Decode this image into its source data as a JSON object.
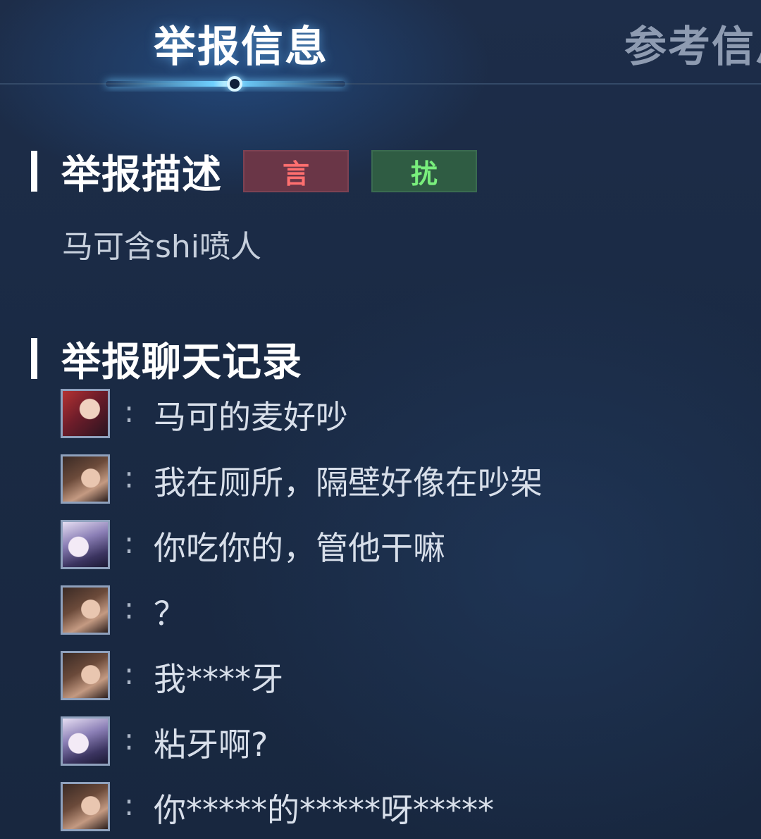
{
  "tabs": {
    "active_label": "举报信息",
    "inactive_label": "参考信息"
  },
  "report_description": {
    "title": "举报描述",
    "tag_red": "言",
    "tag_green": "扰",
    "text": "马可含shi喷人"
  },
  "chat_log": {
    "title": "举报聊天记录",
    "messages": [
      {
        "avatar": "hero-avatar-red",
        "text": "马可的麦好吵"
      },
      {
        "avatar": "hero-avatar-dark",
        "text": "我在厕所，隔壁好像在吵架"
      },
      {
        "avatar": "hero-avatar-purple",
        "text": "你吃你的，管他干嘛"
      },
      {
        "avatar": "hero-avatar-dark",
        "text": "？"
      },
      {
        "avatar": "hero-avatar-dark",
        "text": "我****牙"
      },
      {
        "avatar": "hero-avatar-purple",
        "text": "粘牙啊?"
      },
      {
        "avatar": "hero-avatar-dark",
        "text": "你*****的*****呀*****"
      }
    ]
  },
  "colors": {
    "background": "#1b2a44",
    "tab_indicator": "#6fd0ff",
    "tag_red_bg": "#6a3647",
    "tag_red_text": "#ff6f6f",
    "tag_green_bg": "#2f5c43",
    "tag_green_text": "#79ee7c"
  }
}
